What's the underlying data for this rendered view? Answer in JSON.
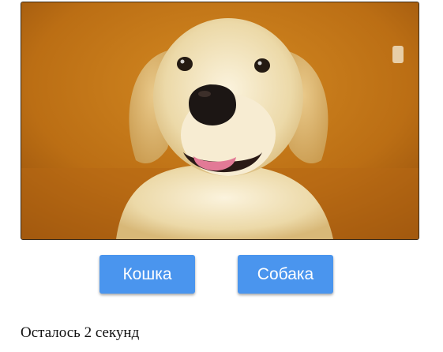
{
  "quiz": {
    "image": {
      "subject": "dog-photo",
      "colors": {
        "background": "#b86a12",
        "fur": "#f3e6c4",
        "nose": "#1c1614",
        "tongue": "#e27a96"
      }
    },
    "buttons": {
      "cat_label": "Кошка",
      "dog_label": "Собака",
      "color": "#4a95ee"
    },
    "timer_text": "Осталось 2 секунд"
  }
}
